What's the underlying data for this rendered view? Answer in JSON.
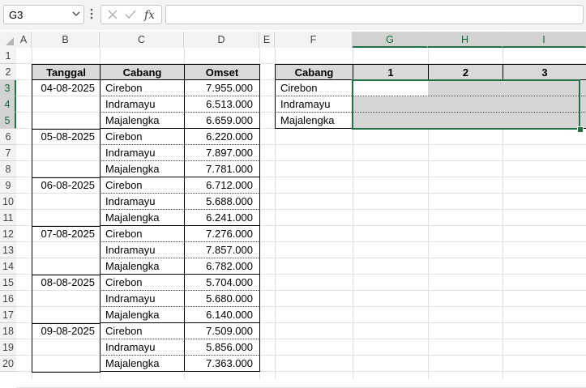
{
  "namebox": {
    "value": "G3"
  },
  "columns": [
    "A",
    "B",
    "C",
    "D",
    "E",
    "F",
    "G",
    "H",
    "I"
  ],
  "rows": [
    "1",
    "2",
    "3",
    "4",
    "5",
    "6",
    "7",
    "8",
    "9",
    "10",
    "11",
    "12",
    "13",
    "14",
    "15",
    "16",
    "17",
    "18",
    "19",
    "20"
  ],
  "table1": {
    "headers": [
      "Tanggal",
      "Cabang",
      "Omset"
    ],
    "dates": [
      "04-08-2025",
      "05-08-2025",
      "06-08-2025",
      "07-08-2025",
      "08-08-2025",
      "09-08-2025"
    ],
    "records": [
      [
        "Cirebon",
        "7.955.000"
      ],
      [
        "Indramayu",
        "6.513.000"
      ],
      [
        "Majalengka",
        "6.659.000"
      ],
      [
        "Cirebon",
        "6.220.000"
      ],
      [
        "Indramayu",
        "7.897.000"
      ],
      [
        "Majalengka",
        "7.781.000"
      ],
      [
        "Cirebon",
        "6.712.000"
      ],
      [
        "Indramayu",
        "5.688.000"
      ],
      [
        "Majalengka",
        "6.241.000"
      ],
      [
        "Cirebon",
        "7.276.000"
      ],
      [
        "Indramayu",
        "7.857.000"
      ],
      [
        "Majalengka",
        "6.782.000"
      ],
      [
        "Cirebon",
        "5.704.000"
      ],
      [
        "Indramayu",
        "5.680.000"
      ],
      [
        "Majalengka",
        "6.140.000"
      ],
      [
        "Cirebon",
        "7.509.000"
      ],
      [
        "Indramayu",
        "5.856.000"
      ],
      [
        "Majalengka",
        "7.363.000"
      ]
    ]
  },
  "table2": {
    "headers": [
      "Cabang",
      "1",
      "2",
      "3"
    ],
    "labels": [
      "Cirebon",
      "Indramayu",
      "Majalengka"
    ]
  },
  "colors": {
    "selection": "#217346",
    "header_fill": "#d9d9d9",
    "grid": "#e1e1e1"
  }
}
